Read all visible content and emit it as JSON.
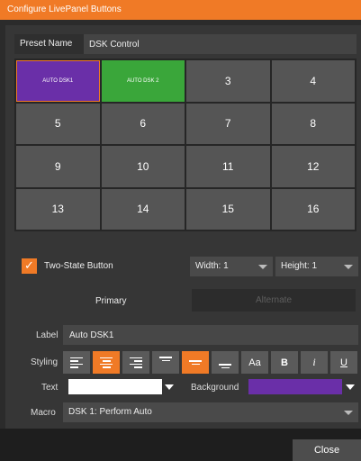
{
  "window": {
    "title": "Configure LivePanel Buttons"
  },
  "preset": {
    "label": "Preset Name",
    "value": "DSK Control"
  },
  "buttons": [
    {
      "label": "AUTO DSK1",
      "color": "#6a2fa8",
      "selected": true
    },
    {
      "label": "AUTO DSK 2",
      "color": "#3aa63a"
    },
    {
      "label": "3"
    },
    {
      "label": "4"
    },
    {
      "label": "5"
    },
    {
      "label": "6"
    },
    {
      "label": "7"
    },
    {
      "label": "8"
    },
    {
      "label": "9"
    },
    {
      "label": "10"
    },
    {
      "label": "11"
    },
    {
      "label": "12"
    },
    {
      "label": "13"
    },
    {
      "label": "14"
    },
    {
      "label": "15"
    },
    {
      "label": "16"
    }
  ],
  "two_state": {
    "label": "Two-State Button",
    "checked": true
  },
  "width": {
    "label": "Width: 1"
  },
  "height": {
    "label": "Height: 1"
  },
  "tabs": {
    "primary": "Primary",
    "alternate": "Alternate"
  },
  "label_field": {
    "label": "Label",
    "value": "Auto DSK1"
  },
  "styling": {
    "label": "Styling",
    "buttons": [
      {
        "name": "align-left-icon",
        "active": false
      },
      {
        "name": "align-center-icon",
        "active": true
      },
      {
        "name": "align-right-icon",
        "active": false
      },
      {
        "name": "valign-top-icon",
        "active": false
      },
      {
        "name": "valign-middle-icon",
        "active": true
      },
      {
        "name": "valign-bottom-icon",
        "active": false
      },
      {
        "name": "font-size-icon",
        "text": "Aa"
      },
      {
        "name": "bold-icon",
        "text": "B"
      },
      {
        "name": "italic-icon",
        "text": "i"
      },
      {
        "name": "underline-icon",
        "text": "U"
      }
    ]
  },
  "text_color": {
    "label": "Text",
    "color": "#ffffff"
  },
  "background_color": {
    "label": "Background",
    "color": "#6a2fa8"
  },
  "macro": {
    "label": "Macro",
    "value": "DSK 1: Perform Auto"
  },
  "footer": {
    "close_label": "Close"
  },
  "colors": {
    "accent": "#f07a26",
    "panel": "#363636",
    "button": "#555555"
  }
}
